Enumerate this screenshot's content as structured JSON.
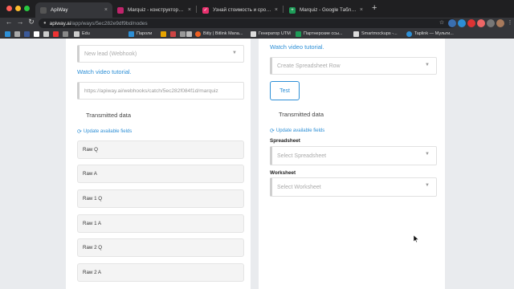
{
  "browser": {
    "tabs": [
      {
        "label": "ApiWay",
        "color": "#555"
      },
      {
        "label": "Marquiz - конструктор марке",
        "color": "#c0246b"
      },
      {
        "label": "Узнай стоимость и сроки вы",
        "color": "#e8316e"
      },
      {
        "label": "Marquiz - Google Таблицы",
        "color": "#1e9c58"
      }
    ],
    "tab_close_glyph": "×",
    "new_tab_glyph": "+",
    "url_host": "apiway.ai",
    "url_path": "/app/ways/5ec282e9df9bd/nodes",
    "bookmarks": [
      {
        "label": "",
        "color": "#2d8fd6"
      },
      {
        "label": "",
        "color": "#aaa"
      },
      {
        "label": "",
        "color": "#3b5998"
      },
      {
        "label": "",
        "color": "#ffffff"
      },
      {
        "label": "",
        "color": "#cccccc"
      },
      {
        "label": "",
        "color": "#e33"
      },
      {
        "label": "",
        "color": "#888"
      },
      {
        "label": "Edu",
        "color": "#ccc"
      },
      {
        "label": "Пароли",
        "color": "#2d8fd6"
      },
      {
        "label": "",
        "color": "#e6a400"
      },
      {
        "label": "",
        "color": "#cc4444"
      },
      {
        "label": "",
        "color": "#999"
      },
      {
        "label": "",
        "color": "#bbb"
      },
      {
        "label": "Bitly | Bitlink Mana...",
        "color": "#ee6123"
      },
      {
        "label": "Генератор UTM",
        "color": "#ddd"
      },
      {
        "label": "Партнерские ссы...",
        "color": "#1e9c58"
      },
      {
        "label": "Smartmockups -...",
        "color": "#ddd"
      },
      {
        "label": "Taplink — Мульти...",
        "color": "#2d8fd6"
      }
    ]
  },
  "left_panel": {
    "trigger_select": "New lead (Webhook)",
    "watch_video": "Watch video tutorial.",
    "webhook_url": "https://apiway.ai/webhooks/catch/5ec282f084f1d/marquiz",
    "transmitted_title": "Transmitted data",
    "update_fields": "Update available fields",
    "rows": [
      "Raw Q",
      "Raw A",
      "Raw 1 Q",
      "Raw 1 A",
      "Raw 2 Q",
      "Raw 2 A"
    ]
  },
  "right_panel": {
    "watch_video": "Watch video tutorial.",
    "action_select": "Create Spreadsheet Row",
    "test_button": "Test",
    "transmitted_title": "Transmitted data",
    "update_fields": "Update available fields",
    "spreadsheet_label": "Spreadsheet",
    "spreadsheet_placeholder": "Select Spreadsheet",
    "worksheet_label": "Worksheet",
    "worksheet_placeholder": "Select Worksheet"
  },
  "icons": {
    "chevron": "▼",
    "refresh": "⟳",
    "lock": "🔒"
  }
}
